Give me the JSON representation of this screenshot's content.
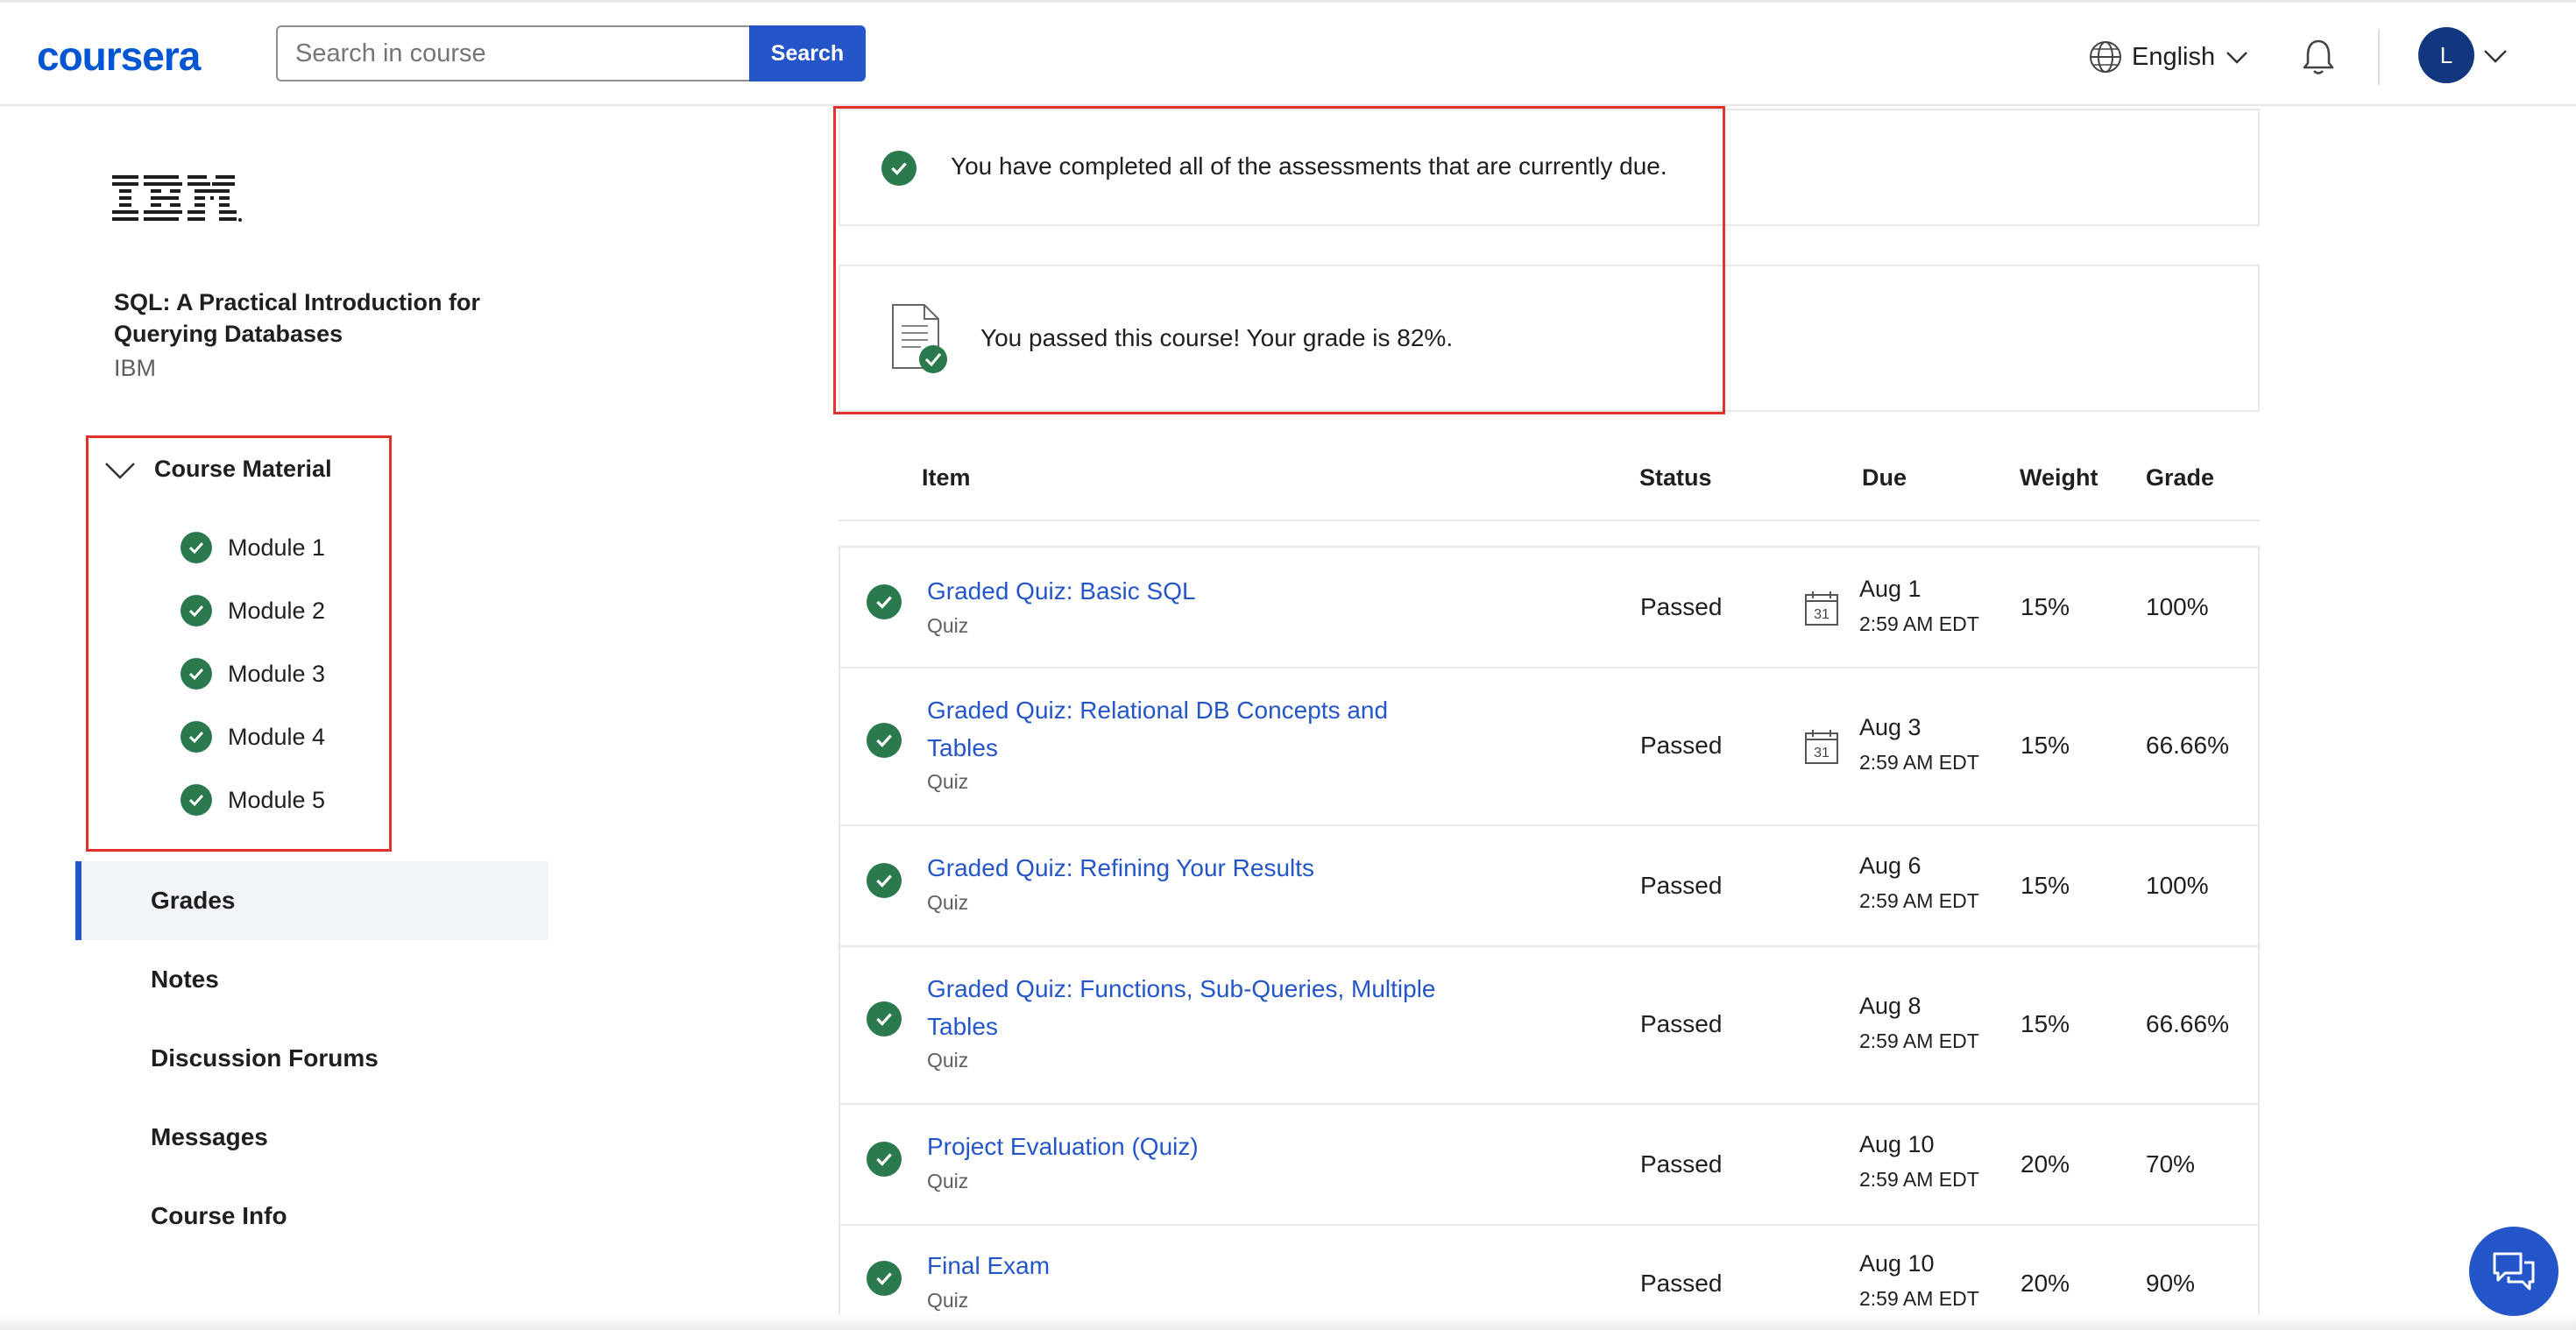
{
  "header": {
    "logo": "coursera",
    "search_placeholder": "Search in course",
    "search_button": "Search",
    "language": "English",
    "avatar_initial": "L"
  },
  "sidebar": {
    "partner_logo": "IBM",
    "course_title": "SQL: A Practical Introduction for Querying Databases",
    "course_org": "IBM",
    "course_material_label": "Course Material",
    "modules": [
      "Module 1",
      "Module 2",
      "Module 3",
      "Module 4",
      "Module 5"
    ],
    "nav": [
      "Grades",
      "Notes",
      "Discussion Forums",
      "Messages",
      "Course Info"
    ],
    "active_nav": "Grades"
  },
  "notices": {
    "assessments": "You have completed all of the assessments that are currently due.",
    "passed": "You passed this course! Your grade is 82%."
  },
  "table": {
    "headers": {
      "item": "Item",
      "status": "Status",
      "due": "Due",
      "weight": "Weight",
      "grade": "Grade"
    },
    "rows": [
      {
        "name": "Graded Quiz: Basic SQL",
        "type": "Quiz",
        "status": "Passed",
        "due_date": "Aug 1",
        "due_time": "2:59 AM EDT",
        "calendar": "31",
        "weight": "15%",
        "grade": "100%"
      },
      {
        "name": "Graded Quiz: Relational DB Concepts and Tables",
        "type": "Quiz",
        "status": "Passed",
        "due_date": "Aug 3",
        "due_time": "2:59 AM EDT",
        "calendar": "31",
        "weight": "15%",
        "grade": "66.66%"
      },
      {
        "name": "Graded Quiz: Refining Your Results",
        "type": "Quiz",
        "status": "Passed",
        "due_date": "Aug 6",
        "due_time": "2:59 AM EDT",
        "weight": "15%",
        "grade": "100%"
      },
      {
        "name": "Graded Quiz: Functions, Sub-Queries, Multiple Tables",
        "type": "Quiz",
        "status": "Passed",
        "due_date": "Aug 8",
        "due_time": "2:59 AM EDT",
        "weight": "15%",
        "grade": "66.66%"
      },
      {
        "name": "Project Evaluation (Quiz)",
        "type": "Quiz",
        "status": "Passed",
        "due_date": "Aug 10",
        "due_time": "2:59 AM EDT",
        "weight": "20%",
        "grade": "70%"
      },
      {
        "name": "Final Exam",
        "type": "Quiz",
        "status": "Passed",
        "due_date": "Aug 10",
        "due_time": "2:59 AM EDT",
        "weight": "20%",
        "grade": "90%"
      }
    ]
  },
  "colors": {
    "brand_blue": "#0056d2",
    "button_blue": "#2456c9",
    "success_green": "#2a7a4d",
    "highlight_red": "#e0312b"
  }
}
